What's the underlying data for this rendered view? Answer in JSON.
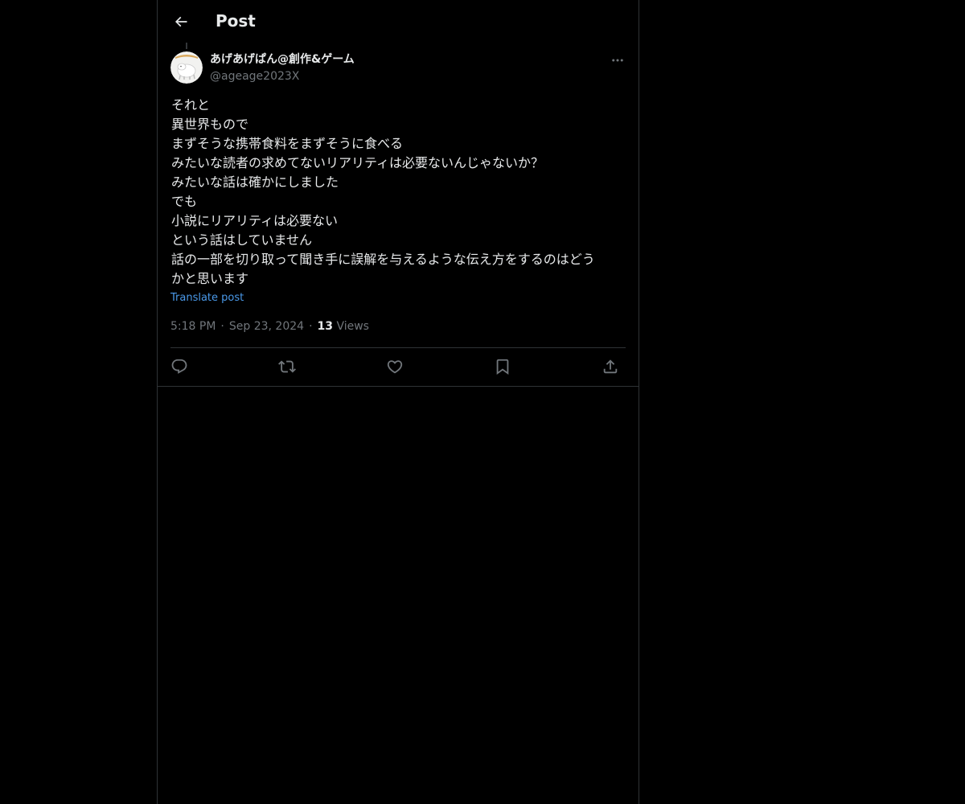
{
  "header": {
    "title": "Post",
    "back_icon": "arrow-left-icon"
  },
  "post": {
    "author": {
      "display_name": "あげあげぱん@創作&ゲーム",
      "handle": "@ageage2023X"
    },
    "text_lines": [
      "それと",
      "異世界もので",
      "まずそうな携帯食料をまずそうに食べる",
      "みたいな読者の求めてないリアリティは必要ないんじゃないか？",
      "みたいな話は確かにしました",
      "でも",
      "小説にリアリティは必要ない",
      "という話はしていません",
      "話の一部を切り取って聞き手に誤解を与えるような伝え方をするのはどう",
      "かと思います"
    ],
    "translate_label": "Translate post",
    "time": "5:18 PM",
    "date": "Sep 23, 2024",
    "separator": "·",
    "views_count": "13",
    "views_label": "Views"
  },
  "actions": {
    "reply_icon": "reply-icon",
    "repost_icon": "repost-icon",
    "like_icon": "heart-icon",
    "bookmark_icon": "bookmark-icon",
    "share_icon": "share-icon"
  },
  "colors": {
    "background": "#000000",
    "text": "#e7e9ea",
    "secondary_text": "#71767b",
    "link": "#4a99e9",
    "border": "#2f3336"
  }
}
